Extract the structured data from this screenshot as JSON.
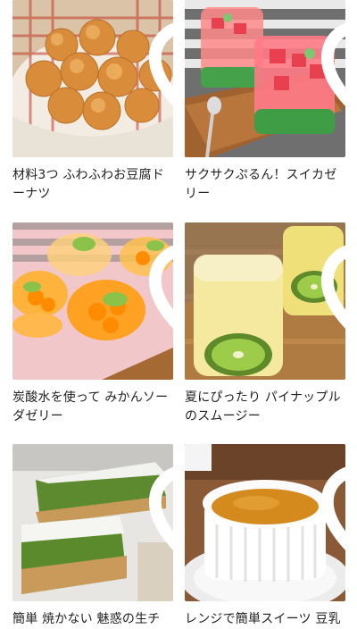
{
  "recipes": [
    {
      "title": "材料3つ ふわふわお豆腐ドーナツ",
      "favorite_icon": "heart-outline-icon"
    },
    {
      "title": "サクサクぷるん！スイカゼリー",
      "favorite_icon": "heart-outline-icon"
    },
    {
      "title": "炭酸水を使って みかんソーダゼリー",
      "favorite_icon": "heart-outline-icon"
    },
    {
      "title": "夏にぴったり パイナップルのスムージー",
      "favorite_icon": "heart-outline-icon"
    },
    {
      "title": "簡単 焼かない 魅惑の生チ",
      "favorite_icon": "heart-outline-icon"
    },
    {
      "title": "レンジで簡単スイーツ 豆乳",
      "favorite_icon": "heart-outline-icon"
    }
  ],
  "colors": {
    "heart": "#ffffff",
    "text": "#222222"
  }
}
